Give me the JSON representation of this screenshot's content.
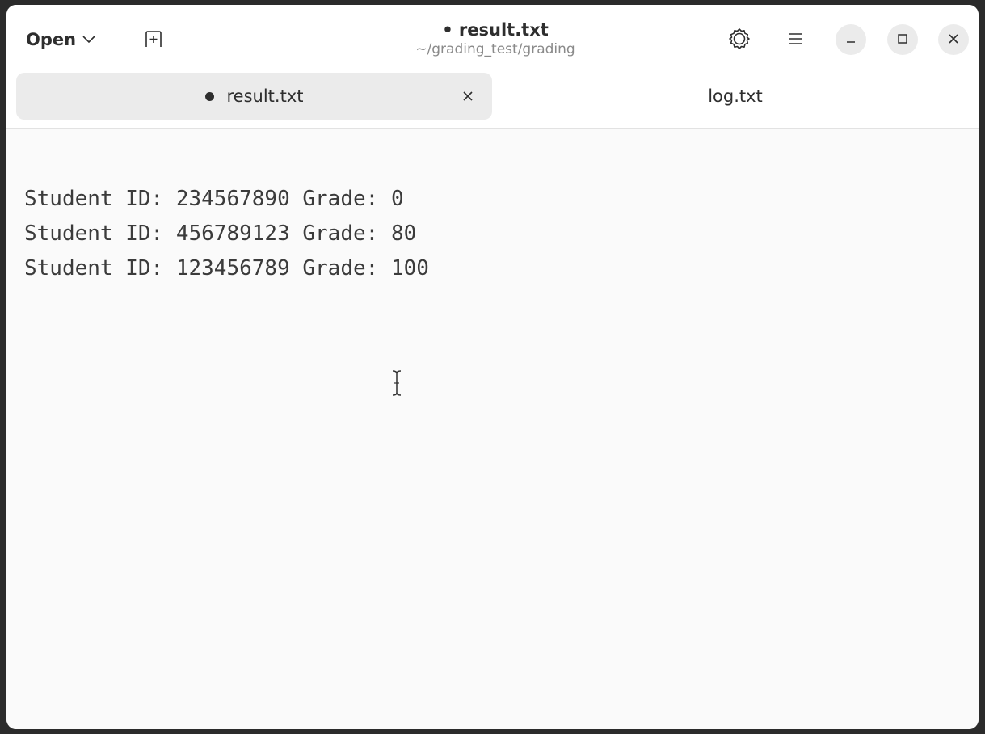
{
  "window": {
    "title": "• result.txt",
    "subtitle": "~/grading_test/grading"
  },
  "headerbar": {
    "open_label": "Open",
    "open_icon": "chevron-down-icon",
    "new_tab_icon": "new-tab-icon",
    "extra_icon": "settings-gear-icon",
    "menu_icon": "hamburger-menu-icon",
    "window_controls": [
      "minimize-icon",
      "maximize-icon",
      "close-icon"
    ]
  },
  "tabs": [
    {
      "label": "result.txt",
      "modified": true,
      "active": true
    },
    {
      "label": "log.txt",
      "modified": false,
      "active": false
    }
  ],
  "editor": {
    "lines": [
      "Student ID: 234567890 Grade: 0",
      "Student ID: 456789123 Grade: 80",
      "Student ID: 123456789 Grade: 100"
    ]
  }
}
